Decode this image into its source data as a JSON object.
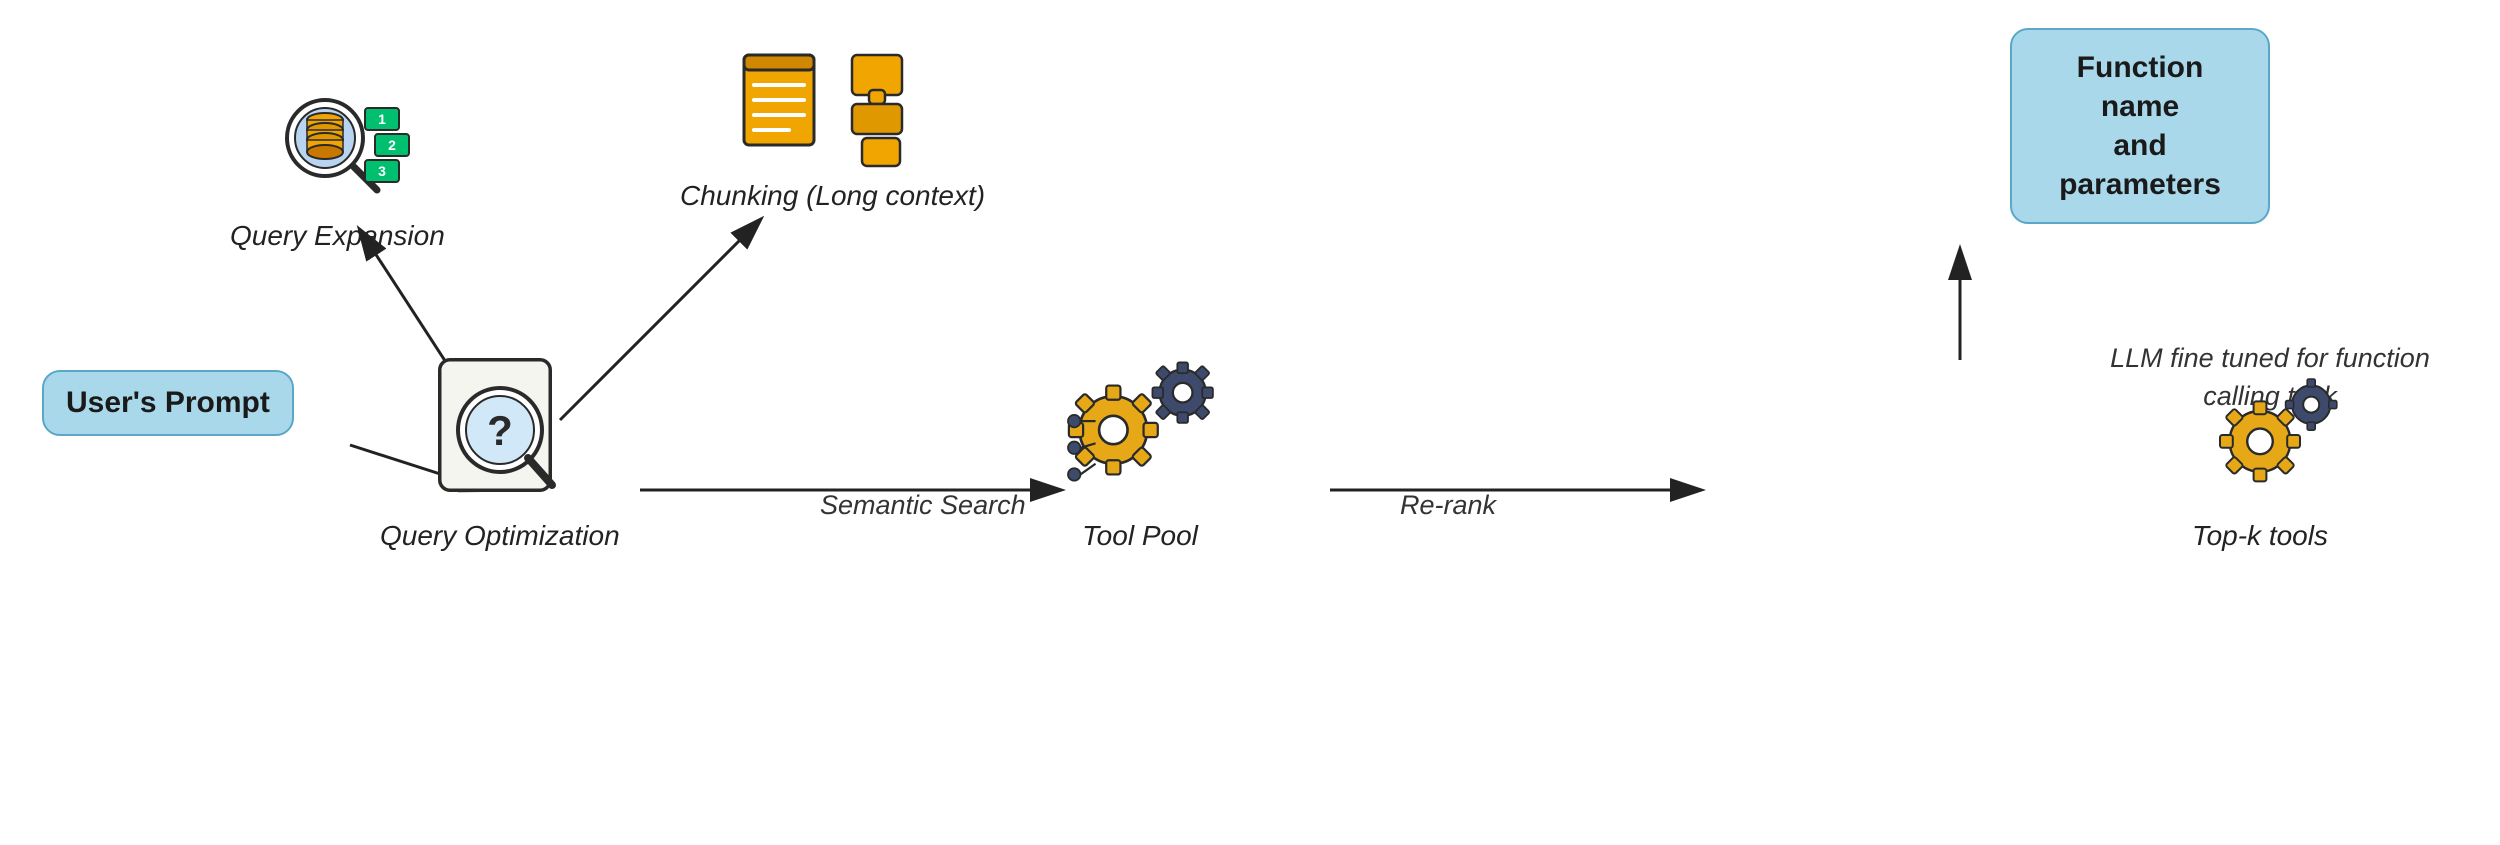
{
  "nodes": {
    "users_prompt": "User's Prompt",
    "function_name": "Function name\nand parameters",
    "query_expansion_label": "Query Expansion",
    "chunking_label": "Chunking (Long context)",
    "query_optimization_label": "Query Optimization",
    "tool_pool_label": "Tool Pool",
    "topk_label": "Top-k tools",
    "semantic_search_label": "Semantic Search",
    "rerank_label": "Re-rank",
    "llm_label": "LLM fine tuned for\nfunction calling task"
  },
  "colors": {
    "light_blue": "#a8d8ea",
    "blue_border": "#5aa7c8",
    "gold": "#f0a500",
    "dark_gray": "#444",
    "gear_dark": "#3d4a6b",
    "gear_gold": "#e6a817"
  }
}
